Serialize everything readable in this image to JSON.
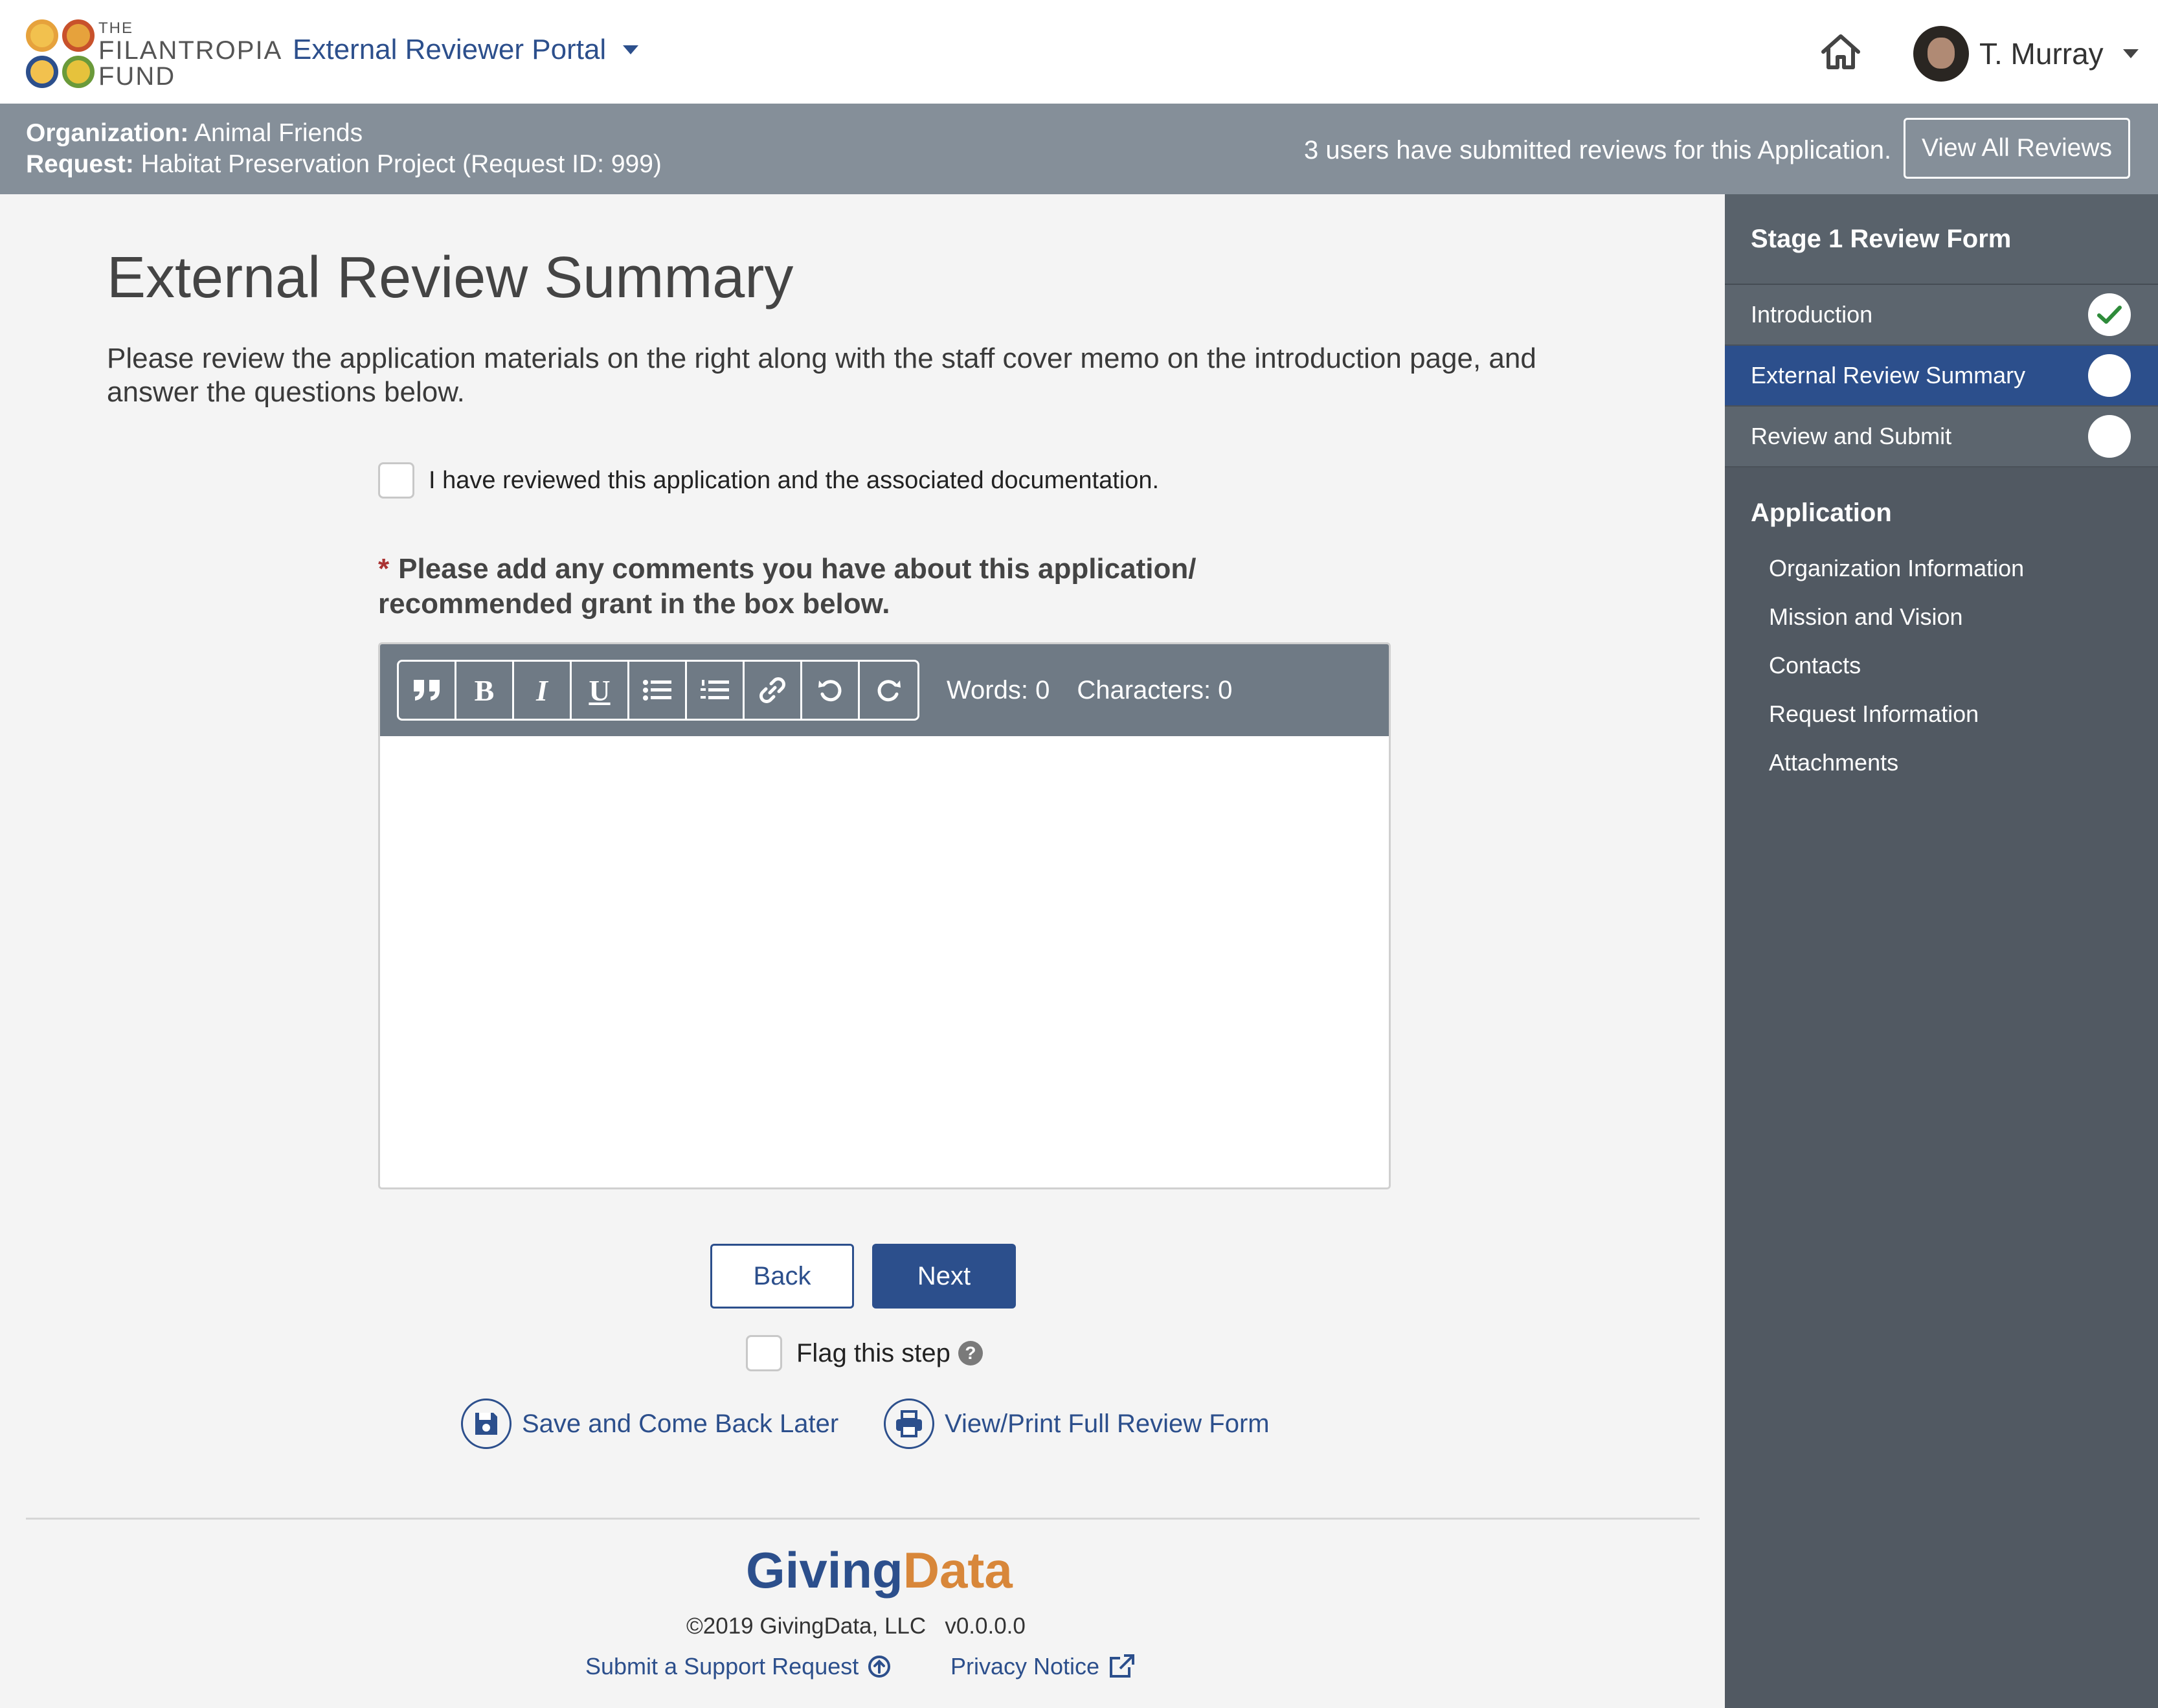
{
  "header": {
    "logo": {
      "line1": "THE",
      "line2": "FILANTROPIA",
      "line3": "FUND"
    },
    "portal_label": "External Reviewer Portal",
    "user_name": "T. Murray"
  },
  "info_bar": {
    "org_label": "Organization:",
    "org_value": "Animal Friends",
    "request_label": "Request:",
    "request_value": "Habitat Preservation Project (Request ID: 999)",
    "submitted_text": "3 users have submitted reviews for this Application.",
    "view_all_label": "View All Reviews"
  },
  "main": {
    "title": "External Review Summary",
    "intro": "Please review the application materials on the right along with the staff cover memo on the introduction page, and answer the questions below.",
    "reviewed_checkbox_label": "I have reviewed this application and the associated documentation.",
    "required_marker": "*",
    "question": "Please add any comments you have about this application/ recommended grant in the box below.",
    "editor": {
      "words_label": "Words: 0",
      "characters_label": "Characters: 0",
      "value": ""
    },
    "back_label": "Back",
    "next_label": "Next",
    "flag_label": "Flag this step",
    "help_glyph": "?",
    "save_label": "Save and Come Back Later",
    "print_label": "View/Print Full Review Form"
  },
  "footer": {
    "brand_giving": "Giving",
    "brand_data": "Data",
    "copyright": "©2019 GivingData, LLC   v0.0.0.0",
    "support_label": "Submit a Support Request",
    "privacy_label": "Privacy Notice"
  },
  "sidebar": {
    "heading": "Stage 1 Review Form",
    "steps": [
      {
        "label": "Introduction",
        "status": "complete"
      },
      {
        "label": "External Review Summary",
        "status": "current"
      },
      {
        "label": "Review and Submit",
        "status": "incomplete"
      }
    ],
    "application_heading": "Application",
    "application_links": [
      "Organization Information",
      "Mission and Vision",
      "Contacts",
      "Request Information",
      "Attachments"
    ]
  },
  "colors": {
    "primary": "#2c4f8c",
    "info_bar": "#858f99",
    "sidebar": "#515962",
    "check_green": "#2e8b3a",
    "brand_orange": "#d8873a"
  }
}
